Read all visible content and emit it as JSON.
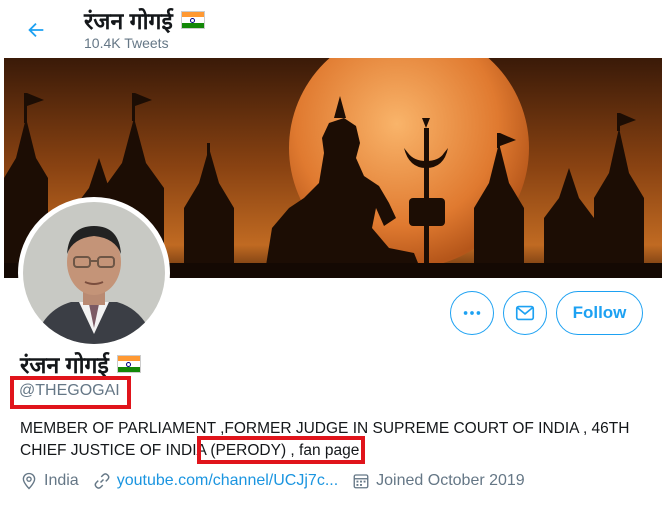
{
  "header": {
    "title": "रंजन गोगई",
    "tweet_count": "10.4K Tweets"
  },
  "profile": {
    "display_name": "रंजन गोगई",
    "handle": "@THEGOGAI",
    "bio_line1": "MEMBER OF PARLIAMENT ,FORMER JUDGE IN SUPREME COURT OF INDIA , 46TH",
    "bio_line2": "CHIEF JUSTICE OF INDIA (PERODY) , fan page",
    "location": "India",
    "website": "youtube.com/channel/UCJj7c...",
    "joined": "Joined October 2019"
  },
  "actions": {
    "follow_label": "Follow"
  },
  "icons": {
    "back": "back-arrow-icon",
    "more": "more-icon",
    "mail": "mail-icon",
    "location": "location-pin-icon",
    "link": "link-icon",
    "calendar": "calendar-icon",
    "flag": "india-flag-icon"
  },
  "colors": {
    "accent": "#1da1f2",
    "link": "#1b95e0",
    "muted": "#657786",
    "annotation": "#e0141b"
  }
}
